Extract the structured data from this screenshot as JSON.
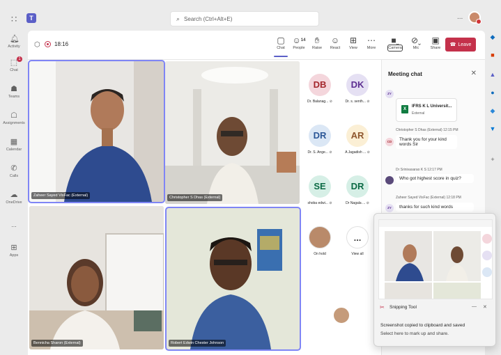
{
  "topbar": {
    "search_placeholder": "Search (Ctrl+Alt+E)",
    "more": "..."
  },
  "rail": {
    "items": [
      {
        "label": "Activity",
        "icon": "bell-icon"
      },
      {
        "label": "Chat",
        "icon": "chat-icon",
        "badge": "1"
      },
      {
        "label": "Teams",
        "icon": "teams-icon"
      },
      {
        "label": "Assignments",
        "icon": "assignments-icon"
      },
      {
        "label": "Calendar",
        "icon": "calendar-icon"
      },
      {
        "label": "Calls",
        "icon": "phone-icon"
      },
      {
        "label": "OneDrive",
        "icon": "cloud-icon"
      },
      {
        "label": "...",
        "icon": "more-icon"
      },
      {
        "label": "Apps",
        "icon": "apps-icon"
      }
    ]
  },
  "meeting": {
    "timer": "18:16",
    "toolbar": [
      {
        "label": "Chat",
        "icon": "chat-icon"
      },
      {
        "label": "People",
        "icon": "people-icon",
        "count": "14"
      },
      {
        "label": "Raise",
        "icon": "hand-icon"
      },
      {
        "label": "React",
        "icon": "smile-icon"
      },
      {
        "label": "View",
        "icon": "grid-icon"
      },
      {
        "label": "More",
        "icon": "more-icon"
      },
      {
        "label": "Camera",
        "icon": "camera-off-icon"
      },
      {
        "label": "Mic",
        "icon": "mic-off-icon"
      },
      {
        "label": "Share",
        "icon": "share-icon"
      }
    ],
    "leave_label": "Leave"
  },
  "videos": [
    {
      "name": "Zaheer Sayed VisFac (External)"
    },
    {
      "name": "Christopher S Dhas (External)"
    },
    {
      "name": "Bennicha Sharon (External)"
    },
    {
      "name": "Robert Edwin Chester Johnson"
    }
  ],
  "participants": [
    {
      "initials": "DB",
      "name": "Dr. Balanag...",
      "bg": "#f4d6dc",
      "fg": "#a4262c"
    },
    {
      "initials": "DK",
      "name": "Dr. s. senth...",
      "bg": "#e5e0f3",
      "fg": "#5c2e91"
    },
    {
      "initials": "DR",
      "name": "Dr. S. Ange...",
      "bg": "#dbe7f5",
      "fg": "#2b5797"
    },
    {
      "initials": "AR",
      "name": "A Jagadish ...",
      "bg": "#fbefd5",
      "fg": "#8e562e"
    },
    {
      "initials": "SE",
      "name": "shoba edwi...",
      "bg": "#d6efe6",
      "fg": "#0b6a44"
    },
    {
      "initials": "DR",
      "name": "Dr Nagala ...",
      "bg": "#d6efe6",
      "fg": "#0b6a44"
    },
    {
      "initials": "",
      "name": "On hold",
      "bg": "#b98a6a",
      "fg": "#ffffff"
    },
    {
      "initials": "...",
      "name": "View all",
      "bg": "#ffffff",
      "fg": "#424242"
    }
  ],
  "chat": {
    "title": "Meeting chat",
    "file_sender_initials": "ZY",
    "file": {
      "name": "IFRS K L Universit...",
      "sub": "External"
    },
    "messages": [
      {
        "meta": "Christopher S Dhas (External)  12:15 PM",
        "initials": "CD",
        "text": "Thank you for your kind words Sir"
      },
      {
        "meta": "Dr Srinivasarao K S  12:17 PM",
        "initials": "",
        "text": "Who got highest score in quiz?"
      },
      {
        "meta": "Zaheer Sayed VisFac (External)  12:18 PM",
        "initials": "ZY",
        "text": "thanks for such kind words"
      }
    ]
  },
  "snip": {
    "app": "Snipping Tool",
    "message": "Screenshot copied to clipboard and saved",
    "sub": "Select here to mark up and share.",
    "min": "—",
    "close": "✕"
  }
}
